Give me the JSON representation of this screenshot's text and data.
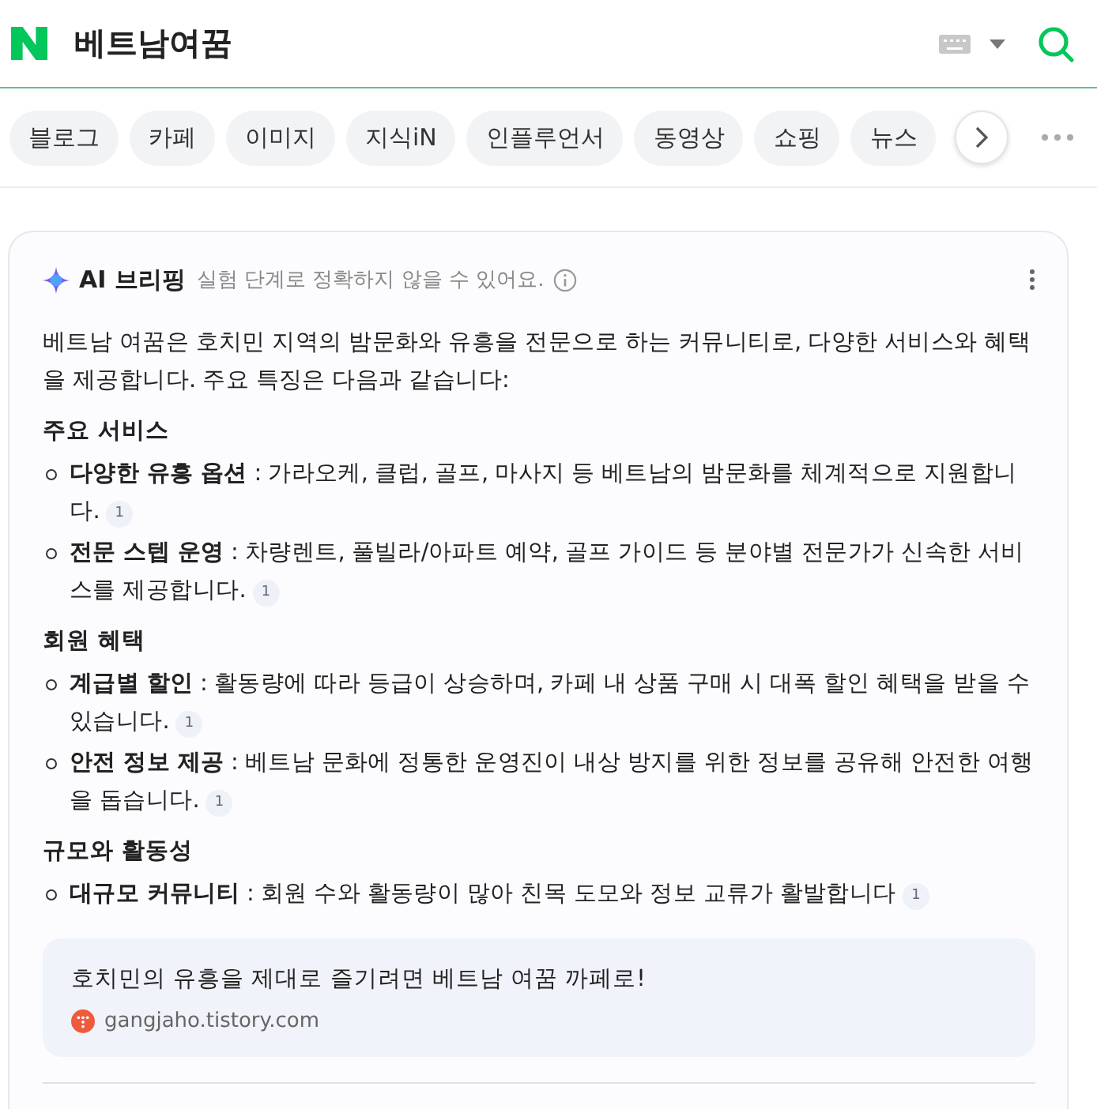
{
  "search": {
    "query": "베트남여꿈"
  },
  "tabs": [
    {
      "label": "블로그",
      "selected": false
    },
    {
      "label": "카페",
      "selected": false
    },
    {
      "label": "이미지",
      "selected": false
    },
    {
      "label": "지식iN",
      "selected": false
    },
    {
      "label": "인플루언서",
      "selected": false
    },
    {
      "label": "동영상",
      "selected": false
    },
    {
      "label": "쇼핑",
      "selected": false
    },
    {
      "label": "뉴스",
      "selected": false
    }
  ],
  "briefing": {
    "title": "AI 브리핑",
    "disclaimer": "실험 단계로 정확하지 않을 수 있어요.",
    "intro": "베트남 여꿈은 호치민 지역의 밤문화와 유흥을 전문으로 하는 커뮤니티로, 다양한 서비스와 혜택을 제공합니다. 주요 특징은 다음과 같습니다:",
    "sections": [
      {
        "heading": "주요 서비스",
        "items": [
          {
            "text": "**다양한 유흥 옵션** : 가라오케, 클럽, 골프, 마사지 등 베트남의 밤문화를 체계적으로 지원합니다.",
            "citation": "1"
          },
          {
            "text": "**전문 스텝 운영** : 차량렌트, 풀빌라/아파트 예약, 골프 가이드 등 분야별 전문가가 신속한 서비스를 제공합니다.",
            "citation": "1"
          }
        ]
      },
      {
        "heading": "회원 혜택",
        "items": [
          {
            "text": "**계급별 할인** : 활동량에 따라 등급이 상승하며, 카페 내 상품 구매 시 대폭 할인 혜택을 받을 수 있습니다.",
            "citation": "1"
          },
          {
            "text": "**안전 정보 제공** : 베트남 문화에 정통한 운영진이 내상 방지를 위한 정보를 공유해 안전한 여행을 돕습니다.",
            "citation": "1"
          }
        ]
      },
      {
        "heading": "규모와 활동성",
        "items": [
          {
            "text": "**대규모 커뮤니티** : 회원 수와 활동량이 많아 친목 도모와 정보 교류가 활발합니다",
            "citation": "1"
          }
        ]
      }
    ],
    "source": {
      "title": "호치민의 유흥을 제대로 즐기려면 베트남 여꿈 까페로!",
      "site": "gangjaho.tistory.com"
    }
  }
}
